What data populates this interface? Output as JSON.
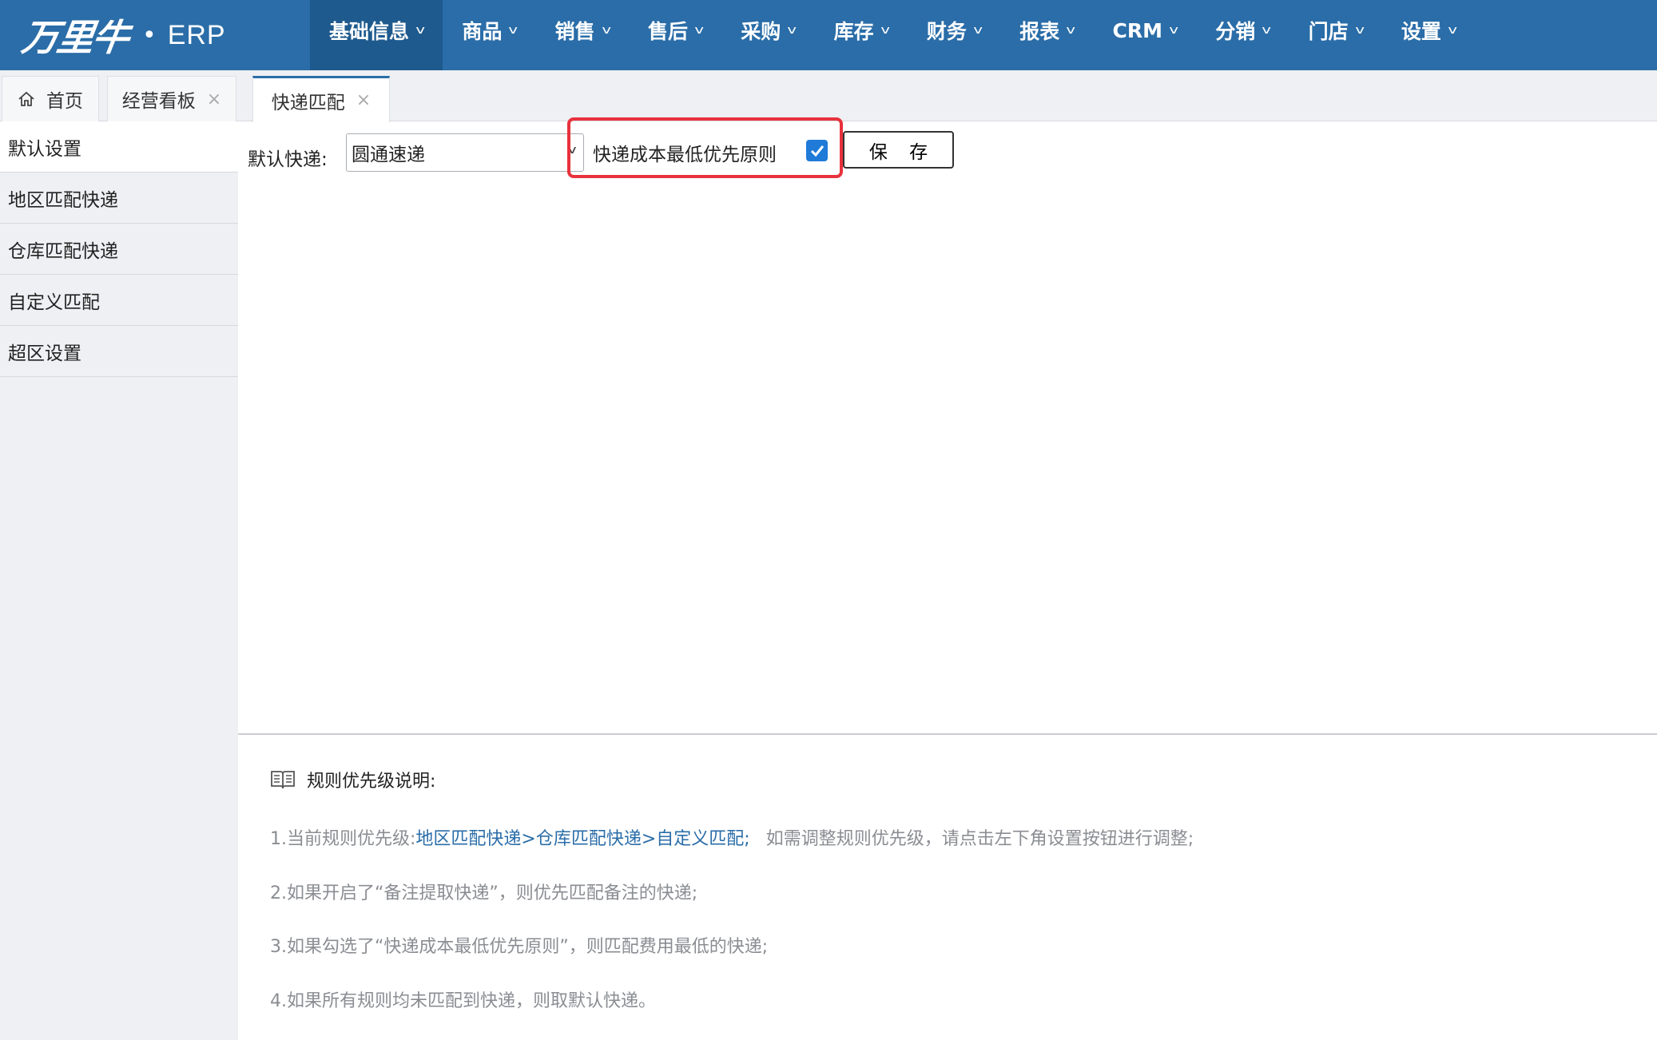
{
  "logo": {
    "brand": "万里牛",
    "dot": "•",
    "product": "ERP"
  },
  "nav": [
    {
      "label": "基础信息",
      "active": true
    },
    {
      "label": "商品"
    },
    {
      "label": "销售"
    },
    {
      "label": "售后"
    },
    {
      "label": "采购"
    },
    {
      "label": "库存"
    },
    {
      "label": "财务"
    },
    {
      "label": "报表"
    },
    {
      "label": "CRM"
    },
    {
      "label": "分销"
    },
    {
      "label": "门店"
    },
    {
      "label": "设置"
    }
  ],
  "tabs": [
    {
      "label": "首页"
    },
    {
      "label": "经营看板",
      "close": "×"
    },
    {
      "label": "快递匹配",
      "close": "×",
      "active": true
    }
  ],
  "sidebar": [
    {
      "label": "默认设置",
      "active": true
    },
    {
      "label": "地区匹配快递"
    },
    {
      "label": "仓库匹配快递"
    },
    {
      "label": "自定义匹配"
    },
    {
      "label": "超区设置"
    }
  ],
  "form": {
    "default_express_label": "默认快递:",
    "default_express_value": "圆通速递",
    "cost_rule_label": "快递成本最低优先原则",
    "cost_rule_checked": true,
    "save_label": "保 存"
  },
  "help": {
    "title": "规则优先级说明:",
    "line1_prefix": "1.当前规则优先级:",
    "line1_link": "地区匹配快递>仓库匹配快递>自定义匹配;",
    "line1_suffix": "如需调整规则优先级，请点击左下角设置按钮进行调整;",
    "line2": "2.如果开启了“备注提取快递”，则优先匹配备注的快递;",
    "line3": "3.如果勾选了“快递成本最低优先原则”，则匹配费用最低的快递;",
    "line4": "4.如果所有规则均未匹配到快递，则取默认快递。"
  },
  "colors": {
    "nav_bg": "#2a6da8",
    "nav_active": "#1e5a8e",
    "highlight": "#e8323c",
    "checkbox": "#1f7ad8",
    "link": "#2a6da8"
  }
}
